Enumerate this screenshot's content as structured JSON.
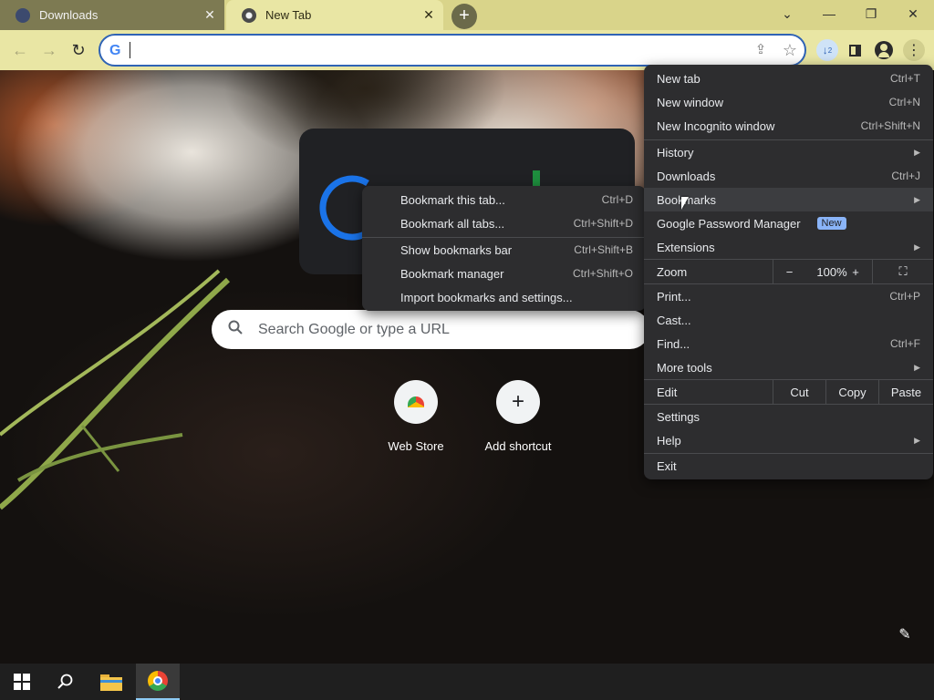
{
  "tabs": [
    {
      "title": "Downloads",
      "close_icon": "close-icon"
    },
    {
      "title": "New Tab",
      "close_icon": "close-icon"
    }
  ],
  "new_tab_glyph": "+",
  "window_controls": {
    "dropdown": "⌄",
    "minimize": "—",
    "restore": "❐",
    "close": "✕"
  },
  "toolbar": {
    "back": "←",
    "forward": "→",
    "reload": "↻",
    "omnibox_value": "",
    "omnibox_g": "G",
    "share": "⇪",
    "star": "☆",
    "download_badge": "2",
    "menu": "⋮"
  },
  "search": {
    "placeholder": "Search Google or type a URL",
    "icon": "🔍"
  },
  "shortcuts": [
    {
      "label": "Web Store"
    },
    {
      "label": "Add shortcut",
      "glyph": "+"
    }
  ],
  "customize_glyph": "✎",
  "main_menu": {
    "new_tab": {
      "label": "New tab",
      "shortcut": "Ctrl+T"
    },
    "new_window": {
      "label": "New window",
      "shortcut": "Ctrl+N"
    },
    "new_incognito": {
      "label": "New Incognito window",
      "shortcut": "Ctrl+Shift+N"
    },
    "history": {
      "label": "History"
    },
    "downloads": {
      "label": "Downloads",
      "shortcut": "Ctrl+J"
    },
    "bookmarks": {
      "label": "Bookmarks"
    },
    "password_manager": {
      "label": "Google Password Manager",
      "badge": "New"
    },
    "extensions": {
      "label": "Extensions"
    },
    "zoom": {
      "label": "Zoom",
      "minus": "−",
      "value": "100%",
      "plus": "+",
      "fullscreen": "⛶"
    },
    "print": {
      "label": "Print...",
      "shortcut": "Ctrl+P"
    },
    "cast": {
      "label": "Cast..."
    },
    "find": {
      "label": "Find...",
      "shortcut": "Ctrl+F"
    },
    "more_tools": {
      "label": "More tools"
    },
    "edit": {
      "label": "Edit",
      "cut": "Cut",
      "copy": "Copy",
      "paste": "Paste"
    },
    "settings": {
      "label": "Settings"
    },
    "help": {
      "label": "Help"
    },
    "exit": {
      "label": "Exit"
    }
  },
  "bookmarks_menu": [
    {
      "label": "Bookmark this tab...",
      "shortcut": "Ctrl+D"
    },
    {
      "label": "Bookmark all tabs...",
      "shortcut": "Ctrl+Shift+D"
    },
    {
      "label": "Show bookmarks bar",
      "shortcut": "Ctrl+Shift+B"
    },
    {
      "label": "Bookmark manager",
      "shortcut": "Ctrl+Shift+O"
    },
    {
      "label": "Import bookmarks and settings...",
      "shortcut": ""
    }
  ],
  "colors": {
    "tab_strip": "#d9d48a",
    "active_tab": "#e9e6a4",
    "omnibox_border": "#2f63b5",
    "menu_bg": "#2d2d2f",
    "new_badge": "#8ab4f8"
  }
}
